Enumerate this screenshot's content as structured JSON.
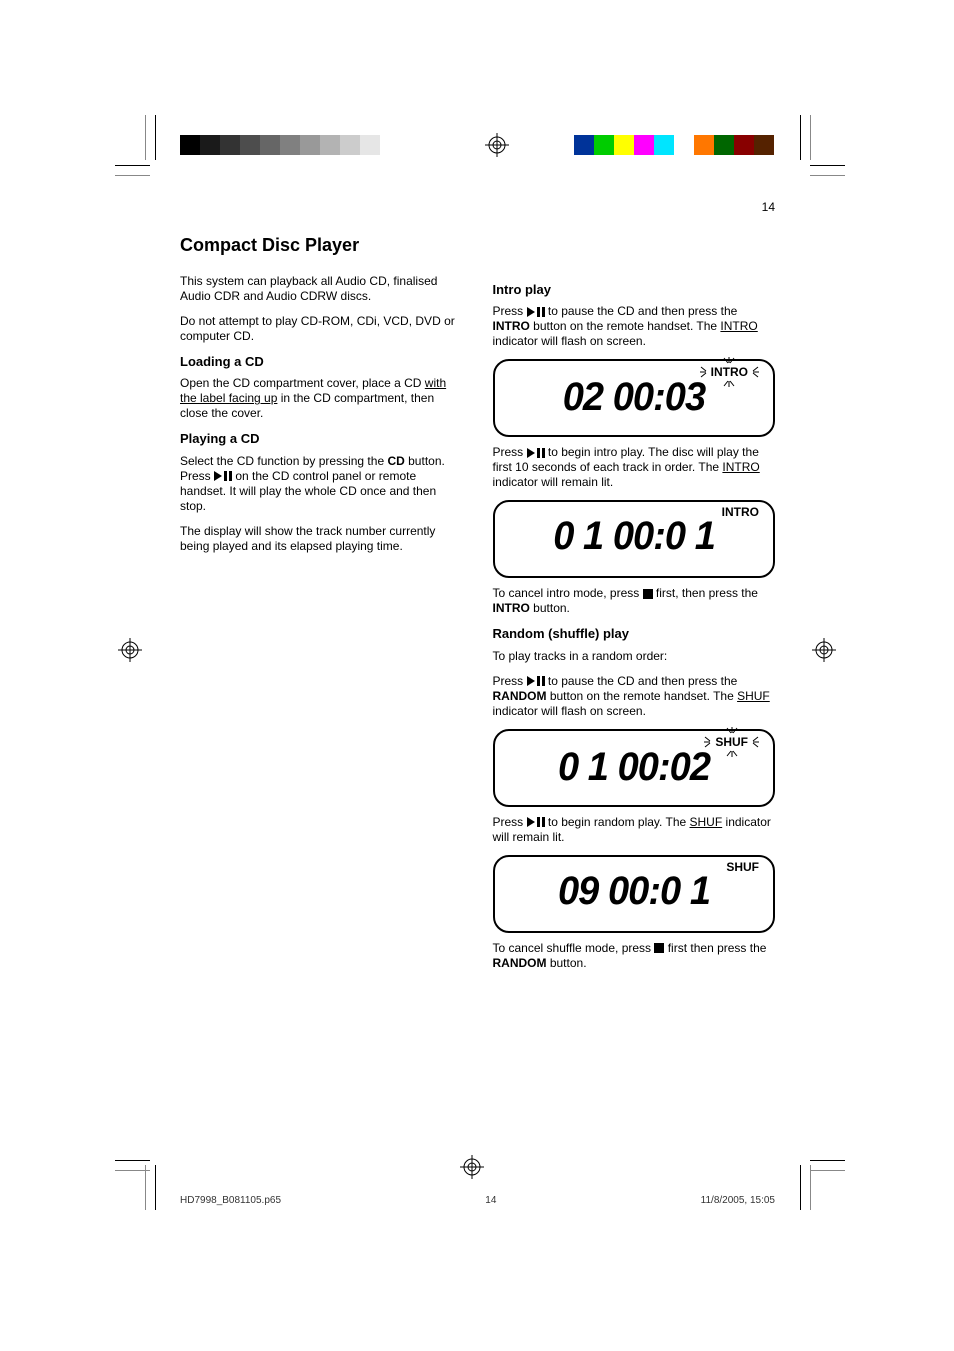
{
  "pageNumberTop": "14",
  "pageTitle": "Compact Disc Player",
  "col1": {
    "intro1": "This system can playback all Audio CD, finalised Audio CDR and Audio CDRW discs.",
    "intro2": "Do not attempt to play CD-ROM, CDi, VCD, DVD or computer CD.",
    "loadingHeading": "Loading a CD",
    "loading1_a": "Open the CD compartment cover, place a CD ",
    "loading1_b": "with the label facing up",
    "loading1_c": " in the CD compartment, then close the cover.",
    "playingHeading": "Playing a CD",
    "play_step1_a": "Select the CD function by pressing the ",
    "play_step1_b": " button. Press ",
    "play_step1_c": " on the CD control panel or remote handset. It will play the whole CD once and then stop.",
    "play_step2": "The display will show the track number currently being played and its elapsed playing time."
  },
  "col2": {
    "introHeading": "Intro play",
    "intro_step1_a": "Press ",
    "intro_step1_b": " to pause the CD and then press the ",
    "intro_step1_c": " button on the remote handset. The ",
    "intro_step1_d": " indicator will flash on screen.",
    "intro_step2_a": "Press ",
    "intro_step2_b": " to begin intro play. The disc will play the first 10 seconds of each track in order. The ",
    "intro_step2_c": " indicator will remain lit.",
    "intro_cancel_a": "To cancel intro mode, press ",
    "intro_cancel_b": " first, then press the ",
    "intro_cancel_c": " button.",
    "intro_label": "INTRO",
    "randomHeading": "Random (shuffle) play",
    "random_intro": "To play tracks in a random order:",
    "rand_step1_a": "Press ",
    "rand_step1_b": " to pause the CD and then press the ",
    "rand_step1_c": " button on the remote handset. The ",
    "rand_step1_d": " indicator will flash on screen.",
    "rand_step2_a": "Press ",
    "rand_step2_b": " to begin random play. The ",
    "rand_step2_c": " indicator will remain lit.",
    "rand_cancel_a": "To cancel shuffle mode, press ",
    "rand_cancel_b": " first then press the ",
    "rand_cancel_c": " button.",
    "shuf_label": "SHUF",
    "cd_btn": "CD",
    "intro_btn": "INTRO",
    "random_btn": "RANDOM"
  },
  "lcd": {
    "intro_flash_tag": "INTRO",
    "intro_flash_time": "02 00:03",
    "intro_on_tag": "INTRO",
    "intro_on_time": "0 1 00:0 1",
    "shuf_flash_tag": "SHUF",
    "shuf_flash_time": "0 1 00:02",
    "shuf_on_tag": "SHUF",
    "shuf_on_time": "09 00:0 1"
  },
  "footer": {
    "file": "HD7998_B081105.p65",
    "page": "14",
    "datetime": "11/8/2005, 15:05"
  },
  "grays": [
    "#000",
    "#1a1a1a",
    "#333",
    "#4d4d4d",
    "#666",
    "#808080",
    "#999",
    "#b3b3b3",
    "#ccc",
    "#e6e6e6",
    "#fff",
    "#fff"
  ],
  "colors": [
    "#003399",
    "#00cc00",
    "#ffff00",
    "#ff00ff",
    "#00e5ff",
    "#ffffff",
    "#ff7700",
    "#006600",
    "#880000",
    "#552200"
  ]
}
